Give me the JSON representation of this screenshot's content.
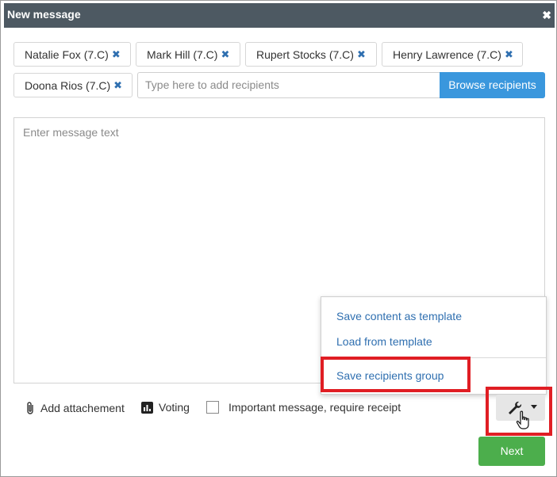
{
  "window": {
    "title": "New message",
    "close_symbol": "✖"
  },
  "recipients": [
    {
      "name": "Natalie Fox (7.C)",
      "remove_symbol": "✖"
    },
    {
      "name": "Mark Hill (7.C)",
      "remove_symbol": "✖"
    },
    {
      "name": "Rupert Stocks (7.C)",
      "remove_symbol": "✖"
    },
    {
      "name": "Henry Lawrence (7.C)",
      "remove_symbol": "✖"
    },
    {
      "name": "Doona Rios (7.C)",
      "remove_symbol": "✖"
    }
  ],
  "recipient_input": {
    "placeholder": "Type here to add recipients",
    "value": ""
  },
  "browse_button": {
    "label": "Browse recipients"
  },
  "message": {
    "placeholder": "Enter message text"
  },
  "tools_menu": {
    "items": [
      {
        "label": "Save content as template"
      },
      {
        "label": "Load from template"
      },
      {
        "label": "Save recipients group"
      }
    ]
  },
  "footer": {
    "attachment_label": "Add attachement",
    "voting_label": "Voting",
    "important_label": "Important message, require receipt"
  },
  "next_button": {
    "label": "Next"
  },
  "colors": {
    "titlebar": "#4d5962",
    "accent": "#3a97dd",
    "link": "#2f6fb0",
    "next": "#4cae4c",
    "highlight": "#e01e24"
  },
  "icons": [
    "close-icon",
    "remove-icon",
    "paperclip-icon",
    "bar-chart-icon",
    "wrench-icon",
    "caret-down-icon",
    "hand-cursor-icon"
  ]
}
